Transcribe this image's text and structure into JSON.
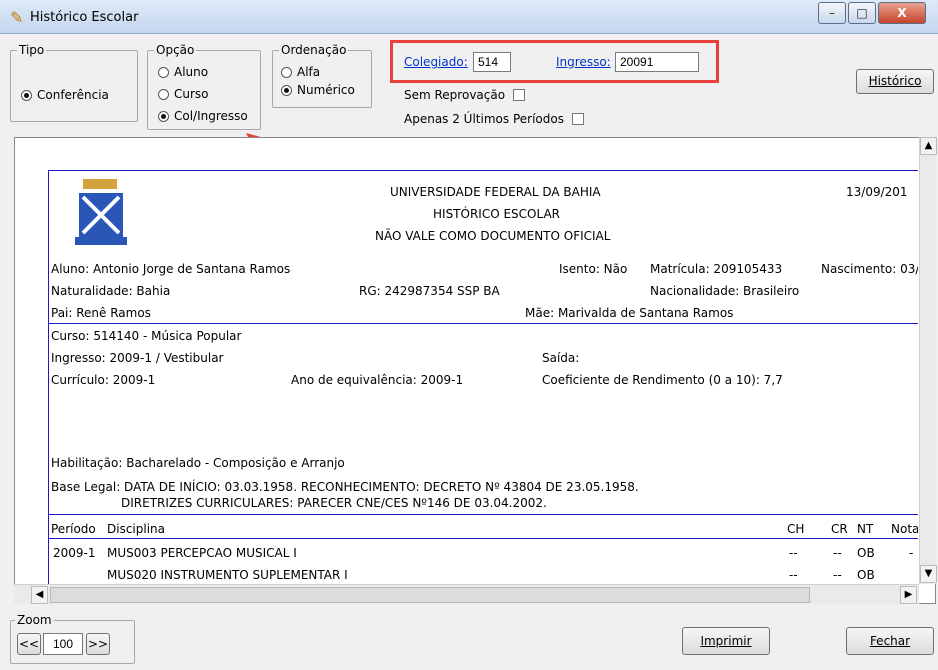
{
  "window": {
    "title": "Histórico Escolar",
    "min": "–",
    "max": "□",
    "close": "X"
  },
  "tipo": {
    "legend": "Tipo",
    "option": "Conferência"
  },
  "opcao": {
    "legend": "Opção",
    "options": [
      "Aluno",
      "Curso",
      "Col/Ingresso"
    ],
    "selected": "Col/Ingresso"
  },
  "ordenacao": {
    "legend": "Ordenação",
    "options": [
      "Alfa",
      "Numérico"
    ],
    "selected": "Numérico"
  },
  "filters": {
    "colegiado_label": "Colegiado:",
    "colegiado_value": "514",
    "ingresso_label": "Ingresso:",
    "ingresso_value": "20091",
    "sem_reprovacao": "Sem Reprovação",
    "apenas_ultimos": "Apenas 2 Últimos Períodos"
  },
  "buttons": {
    "historico": "Histórico",
    "imprimir": "Imprimir",
    "fechar": "Fechar"
  },
  "zoom": {
    "legend": "Zoom",
    "prev": "<<",
    "value": "100",
    "next": ">>"
  },
  "highlight_color": "#e8403a",
  "document": {
    "university": "UNIVERSIDADE FEDERAL DA BAHIA",
    "doc_title": "HISTÓRICO ESCOLAR",
    "disclaimer": "NÃO VALE COMO DOCUMENTO OFICIAL",
    "date": "13/09/201",
    "aluno": "Aluno: Antonio Jorge de Santana Ramos",
    "isento": "Isento: Não",
    "matricula": "Matrícula: 209105433",
    "nascimento": "Nascimento: 03/",
    "naturalidade": "Naturalidade: Bahia",
    "rg": "RG: 242987354 SSP BA",
    "nacionalidade": "Nacionalidade: Brasileiro",
    "pai": "Pai: Renê Ramos",
    "mae": "Mãe: Marivalda de Santana Ramos",
    "curso": "Curso: 514140 - Música Popular",
    "ingresso": "Ingresso: 2009-1 / Vestibular",
    "saida": "Saída:",
    "curriculo": "Currículo: 2009-1",
    "ano_equivalencia": "Ano de equivalência: 2009-1",
    "coeficiente": "Coeficiente de Rendimento (0 a 10):  7,7",
    "habilitacao": "Habilitação: Bacharelado - Composição e Arranjo",
    "base_legal_1": "Base Legal: DATA DE INÍCIO: 03.03.1958. RECONHECIMENTO: DECRETO Nº 43804 DE 23.05.1958.",
    "base_legal_2": "DIRETRIZES CURRICULARES: PARECER CNE/CES Nº146 DE 03.04.2002.",
    "table_headers": {
      "periodo": "Período",
      "disciplina": "Disciplina",
      "ch": "CH",
      "cr": "CR",
      "nt": "NT",
      "nota": "Nota"
    },
    "rows": [
      {
        "periodo": "2009-1",
        "disciplina": "MUS003  PERCEPCAO MUSICAL I",
        "ch": "--",
        "cr": "--",
        "nt": "OB",
        "nota": "-"
      },
      {
        "periodo": "",
        "disciplina": "MUS020  INSTRUMENTO SUPLEMENTAR I",
        "ch": "--",
        "cr": "--",
        "nt": "OB",
        "nota": ""
      }
    ]
  }
}
